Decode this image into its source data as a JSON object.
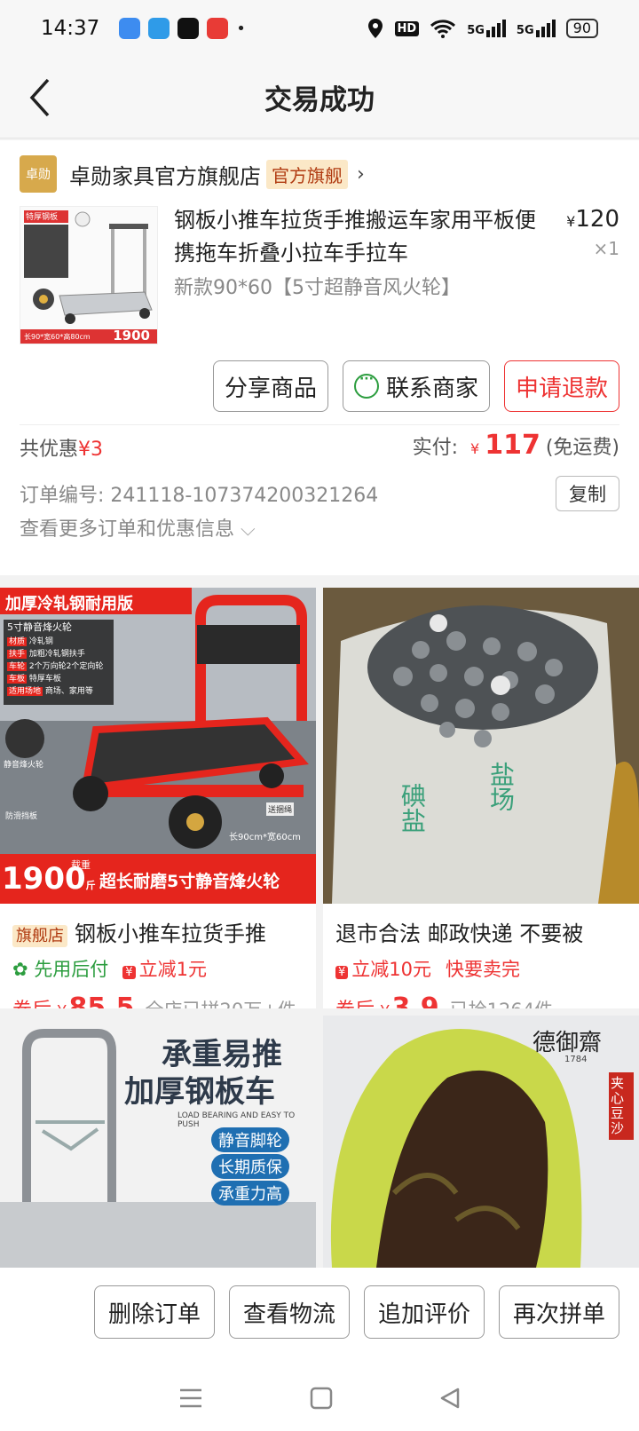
{
  "status": {
    "time": "14:37",
    "network1": "HD",
    "network2": "5G",
    "network3": "5G",
    "battery": "90"
  },
  "nav": {
    "title": "交易成功"
  },
  "order": {
    "shop_logo": "卓勋",
    "shop_name": "卓勋家具官方旗舰店",
    "shop_badge": "官方旗舰",
    "product_title": "钢板小推车拉货手推搬运车家用平板便携拖车折叠小拉车手拉车",
    "product_spec": "新款90*60【5寸超静音风火轮】",
    "price_symbol": "¥",
    "price": "120",
    "qty": "×1",
    "img_tag": "特厚钢板",
    "img_price": "1900",
    "img_size": "长90*宽60*高80cm",
    "img_weight": "载重",
    "btn_share": "分享商品",
    "btn_contact": "联系商家",
    "btn_refund": "申请退款",
    "discount_label": "共优惠",
    "discount_value": "¥3",
    "paid_label": "实付:",
    "paid_symbol": "¥",
    "paid_amount": "117",
    "paid_note": "(免运费)",
    "order_no": "订单编号:  241118-107374200321264",
    "copy": "复制",
    "more_info": "查看更多订单和优惠信息"
  },
  "feed": [
    {
      "banner": "加厚冷轧钢耐用版",
      "spec_title": "5寸静音烽火轮",
      "spec_rows": [
        [
          "材质",
          "冷轧钢"
        ],
        [
          "扶手",
          "加粗冷轧钢扶手"
        ],
        [
          "车轮",
          "2个万向轮2个定向轮"
        ],
        [
          "车板",
          "特厚车板"
        ],
        [
          "适用场地",
          "商场、家用等"
        ]
      ],
      "wheel": "静音烽火轮",
      "anti": "防滑挡板",
      "rope": "送捆绳",
      "size": "长90cm*宽60cm",
      "load_label": "载重",
      "load": "1900",
      "load_unit": "斤",
      "bottom": "超长耐磨5寸静音烽火轮",
      "tag": "旗舰店",
      "title": "钢板小推车拉货手推",
      "sub1": "先用后付",
      "sub2": "立减1元",
      "price_prefix": "券后",
      "price_symbol": "¥",
      "price": "85.5",
      "sold": "全店已拼20万+件"
    },
    {
      "bag_text1": "碘盐",
      "bag_text2": "盐场",
      "title": "退市合法 邮政快递 不要被",
      "sub1": "立减10元",
      "sub2": "快要卖完",
      "price_prefix": "券后",
      "price_symbol": "¥",
      "price": "3.9",
      "sold": "已抢1264件"
    },
    {
      "h1": "承重易推",
      "h2": "加厚钢板车",
      "en": "LOAD BEARING AND EASY TO PUSH",
      "p1": "静音脚轮",
      "p2": "长期质保",
      "p3": "承重力高"
    },
    {
      "brand": "德御齋",
      "year": "1784",
      "label": "夹心豆沙"
    }
  ],
  "actions": [
    "删除订单",
    "查看物流",
    "追加评价",
    "再次拼单"
  ],
  "colors": {
    "accent": "#ee3333",
    "green": "#2c9d3f",
    "badge_bg": "#fbe8c7"
  }
}
